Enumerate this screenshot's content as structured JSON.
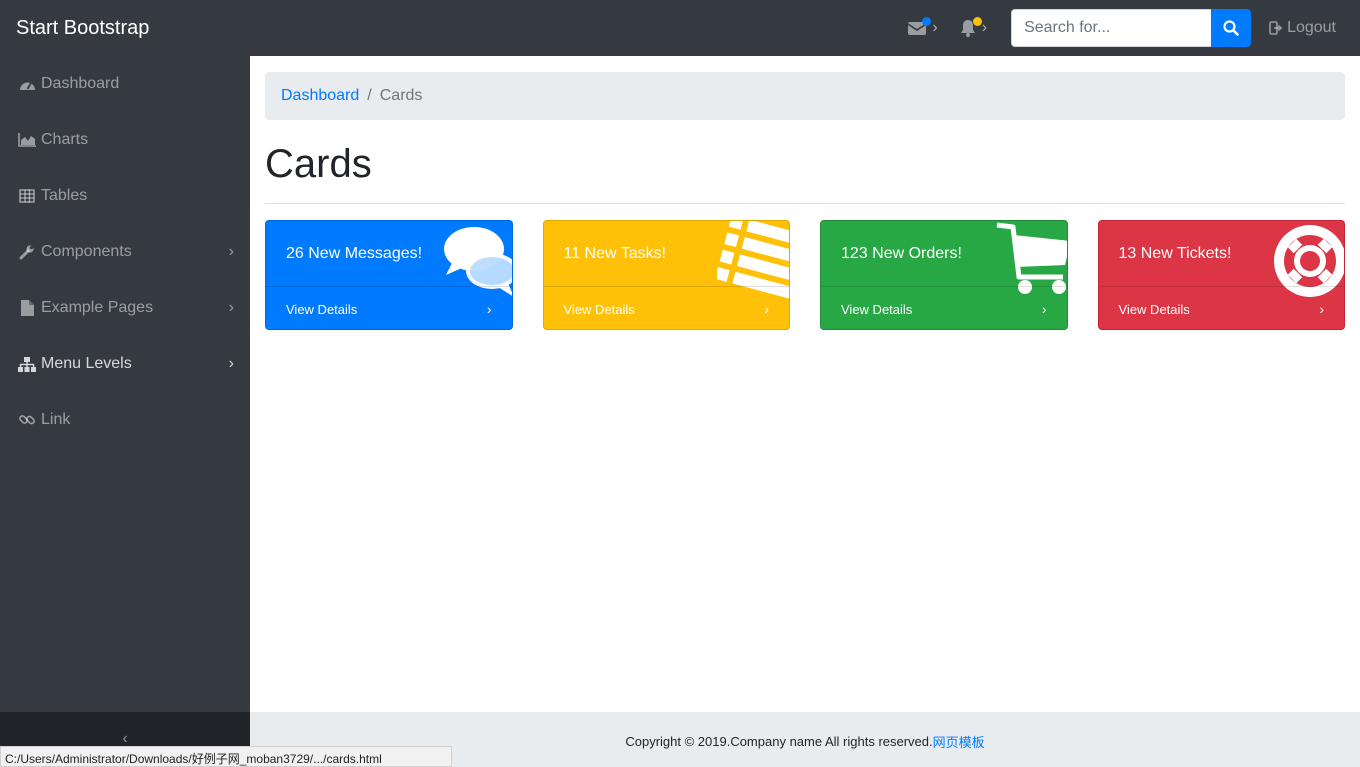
{
  "navbar": {
    "brand": "Start Bootstrap",
    "messages_icon": "envelope-icon",
    "alerts_icon": "bell-icon",
    "search": {
      "placeholder": "Search for...",
      "value": ""
    },
    "logout_label": "Logout"
  },
  "sidebar": {
    "items": [
      {
        "label": "Dashboard",
        "icon": "dashboard-icon",
        "has_submenu": false
      },
      {
        "label": "Charts",
        "icon": "area-chart-icon",
        "has_submenu": false
      },
      {
        "label": "Tables",
        "icon": "table-icon",
        "has_submenu": false
      },
      {
        "label": "Components",
        "icon": "wrench-icon",
        "has_submenu": true
      },
      {
        "label": "Example Pages",
        "icon": "file-icon",
        "has_submenu": true
      },
      {
        "label": "Menu Levels",
        "icon": "sitemap-icon",
        "has_submenu": true
      },
      {
        "label": "Link",
        "icon": "link-icon",
        "has_submenu": false
      }
    ],
    "toggle_glyph": "‹"
  },
  "breadcrumb": {
    "parent": "Dashboard",
    "separator": "/",
    "current": "Cards"
  },
  "page": {
    "title": "Cards"
  },
  "cards": [
    {
      "text": "26 New Messages!",
      "footer": "View Details",
      "color": "#007bff",
      "icon": "comments-icon"
    },
    {
      "text": "11 New Tasks!",
      "footer": "View Details",
      "color": "#ffc107",
      "icon": "list-icon"
    },
    {
      "text": "123 New Orders!",
      "footer": "View Details",
      "color": "#28a745",
      "icon": "shopping-cart-icon"
    },
    {
      "text": "13 New Tickets!",
      "footer": "View Details",
      "color": "#dc3545",
      "icon": "life-ring-icon"
    }
  ],
  "footer": {
    "copyright": "Copyright © 2019.Company name All rights reserved.",
    "link": "网页模板"
  },
  "statusbar": {
    "url": "C:/Users/Administrator/Downloads/好例子网_moban3729/.../cards.html"
  },
  "colors": {
    "messages_dot": "#007bff",
    "alerts_dot": "#ffc107"
  }
}
